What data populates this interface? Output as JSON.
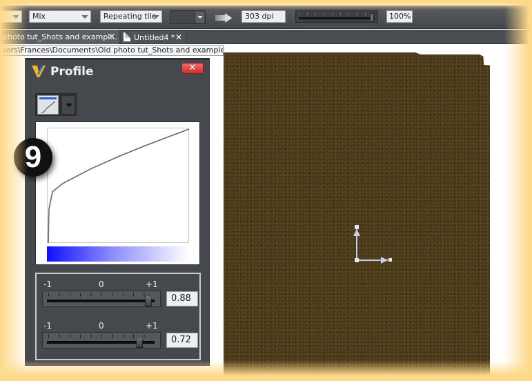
{
  "toolbar": {
    "blend_combo": "Mix",
    "tiling_combo": "Repeating tile",
    "resolution": "303 dpi",
    "transparency_percent": "100%",
    "transparency_slider_fraction": 0.95
  },
  "tabs": [
    {
      "label": "photo tut_Shots and exampl...",
      "close": "✕",
      "active": true
    },
    {
      "label": "Untitled4 *",
      "close": "✕",
      "active": false
    }
  ],
  "tooltip": "sers\\Frances\\Documents\\Old photo tut_Shots and examples *",
  "profile_panel": {
    "title": "Profile",
    "close_label": "✕",
    "graph": {
      "curve_points": [
        [
          0,
          0
        ],
        [
          0.005,
          0.3
        ],
        [
          0.03,
          0.45
        ],
        [
          0.1,
          0.52
        ],
        [
          0.3,
          0.65
        ],
        [
          0.5,
          0.76
        ],
        [
          0.7,
          0.86
        ],
        [
          0.85,
          0.93
        ],
        [
          1,
          1
        ]
      ],
      "gradient_start_color": "#1010ff",
      "gradient_end_color": "#ffffff"
    },
    "sliders": [
      {
        "min_label": "-1",
        "mid_label": "0",
        "max_label": "+1",
        "value": "0.88",
        "numeric": 0.88
      },
      {
        "min_label": "-1",
        "mid_label": "0",
        "max_label": "+1",
        "value": "0.72",
        "numeric": 0.72
      }
    ]
  },
  "step_badge": "9"
}
